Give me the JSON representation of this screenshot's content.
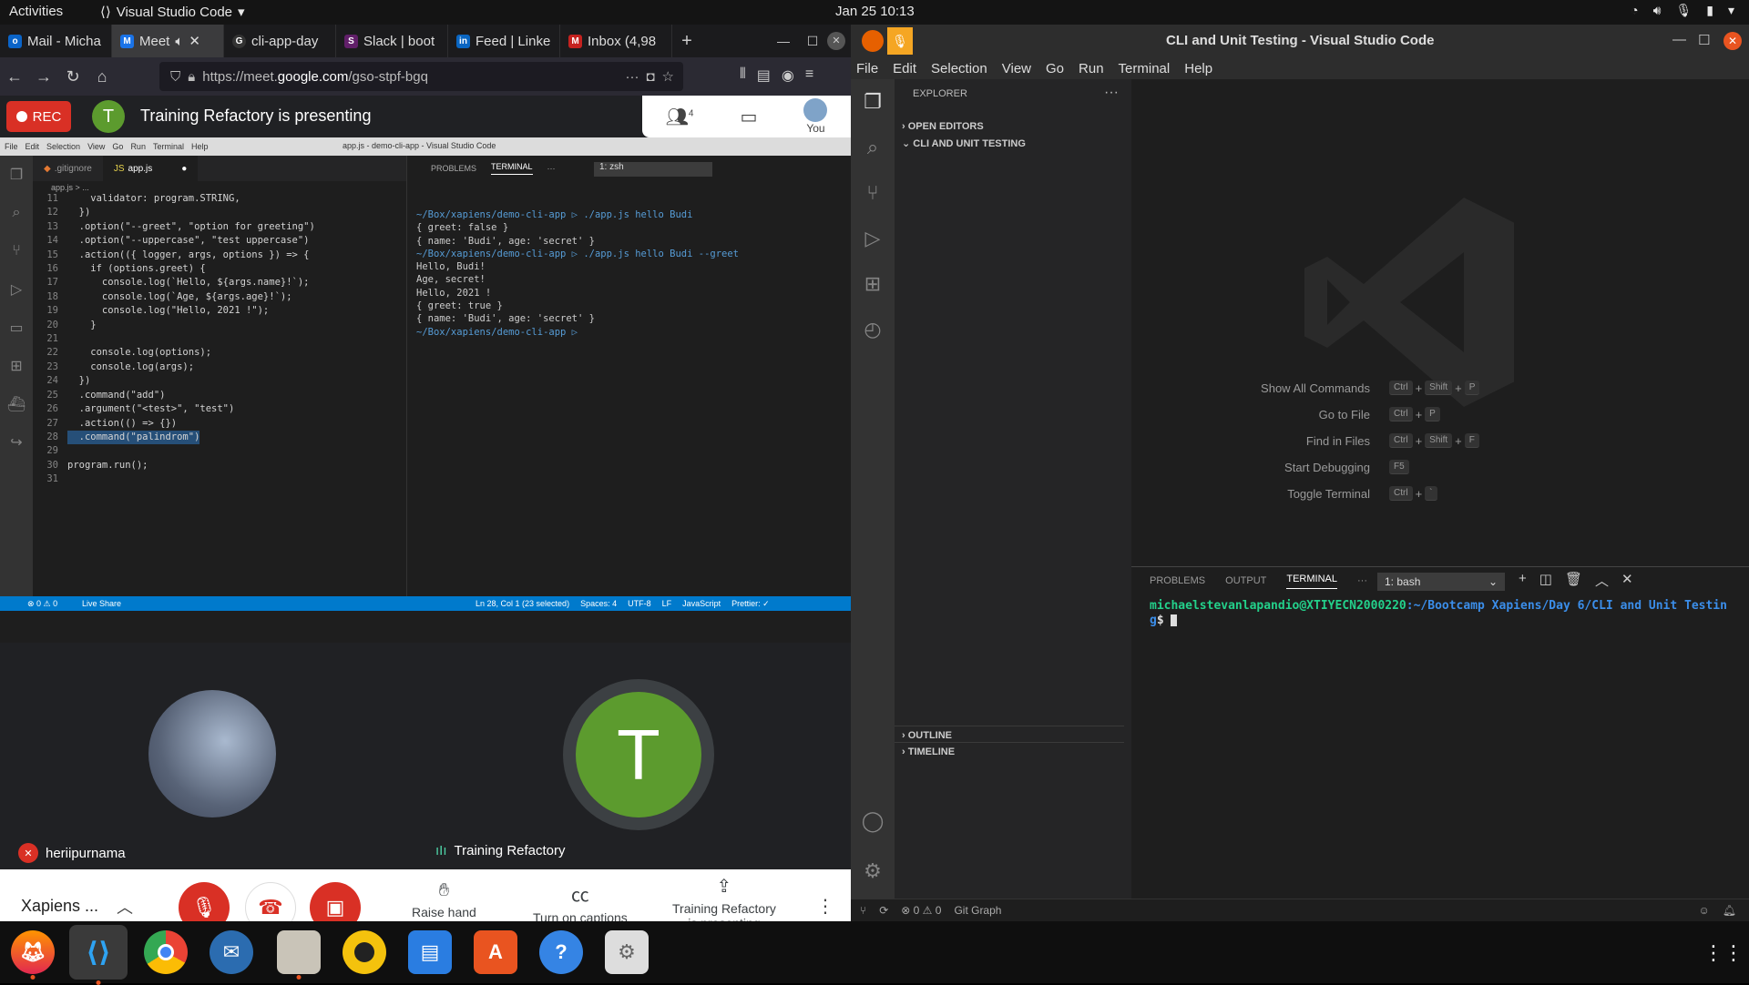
{
  "topbar": {
    "activities": "Activities",
    "app": "Visual Studio Code",
    "clock": "Jan 25  10:13"
  },
  "firefox": {
    "tabs": [
      {
        "label": "Mail - Micha",
        "color": "#0a64c8",
        "glyph": "o"
      },
      {
        "label": "Meet",
        "color": "#1a73e8",
        "glyph": "M"
      },
      {
        "label": "cli-app-day",
        "color": "#333333",
        "glyph": "G"
      },
      {
        "label": "Slack | boot",
        "color": "#611f69",
        "glyph": "S"
      },
      {
        "label": "Feed | Linke",
        "color": "#0a66c2",
        "glyph": "in"
      },
      {
        "label": "Inbox (4,98",
        "color": "#c5221f",
        "glyph": "M"
      }
    ],
    "url_prefix": "https://meet.",
    "url_domain": "google.com",
    "url_path": "/gso-stpf-bgq"
  },
  "meet": {
    "rec": "REC",
    "presenter_initial": "T",
    "presenting_text": "Training Refactory is presenting",
    "people_count": "4",
    "you": "You",
    "participant1": "heriipurnama",
    "participant2": "Training Refactory",
    "participant2_initial": "T",
    "meeting_name": "Xapiens ...",
    "raise_hand": "Raise hand",
    "captions": "Turn on captions",
    "presenting_line1": "Training Refactory",
    "presenting_line2": "is presenting"
  },
  "shared_vscode": {
    "menu": [
      "File",
      "Edit",
      "Selection",
      "View",
      "Go",
      "Run",
      "Terminal",
      "Help"
    ],
    "title": "app.js - demo-cli-app - Visual Studio Code",
    "tabs": [
      ".gitignore",
      "app.js"
    ],
    "breadcrumb": "app.js > ...",
    "code": [
      {
        "n": "11",
        "t": "    validator: program.STRING,"
      },
      {
        "n": "12",
        "t": "  })"
      },
      {
        "n": "13",
        "t": "  .option(\"--greet\", \"option for greeting\")"
      },
      {
        "n": "14",
        "t": "  .option(\"--uppercase\", \"test uppercase\")"
      },
      {
        "n": "15",
        "t": "  .action(({ logger, args, options }) => {"
      },
      {
        "n": "16",
        "t": "    if (options.greet) {"
      },
      {
        "n": "17",
        "t": "      console.log(`Hello, ${args.name}!`);"
      },
      {
        "n": "18",
        "t": "      console.log(`Age, ${args.age}!`);"
      },
      {
        "n": "19",
        "t": "      console.log(\"Hello, 2021 !\");"
      },
      {
        "n": "20",
        "t": "    }"
      },
      {
        "n": "21",
        "t": ""
      },
      {
        "n": "22",
        "t": "    console.log(options);"
      },
      {
        "n": "23",
        "t": "    console.log(args);"
      },
      {
        "n": "24",
        "t": "  })"
      },
      {
        "n": "25",
        "t": "  .command(\"add\")"
      },
      {
        "n": "26",
        "t": "  .argument(\"<test>\", \"test\")"
      },
      {
        "n": "27",
        "t": "  .action(() => {})"
      },
      {
        "n": "28",
        "t": "  .command(\"palindrom\")"
      },
      {
        "n": "29",
        "t": ""
      },
      {
        "n": "30",
        "t": "program.run();"
      },
      {
        "n": "31",
        "t": ""
      }
    ],
    "term_tabs": [
      "PROBLEMS",
      "TERMINAL"
    ],
    "term_select": "1: zsh",
    "terminal": [
      "~/Box/xapiens/demo-cli-app ▷ ./app.js hello Budi",
      "{ greet: false }",
      "{ name: 'Budi', age: 'secret' }",
      "~/Box/xapiens/demo-cli-app ▷ ./app.js hello Budi --greet",
      "Hello, Budi!",
      "Age, secret!",
      "Hello, 2021 !",
      "{ greet: true }",
      "{ name: 'Budi', age: 'secret' }",
      "~/Box/xapiens/demo-cli-app ▷ "
    ],
    "status_left": "⊗ 0 ⚠ 0",
    "live_share": "Live Share",
    "status_right": [
      "Ln 28, Col 1 (23 selected)",
      "Spaces: 4",
      "UTF-8",
      "LF",
      "JavaScript",
      "Prettier: ✓"
    ]
  },
  "vscode": {
    "title": "CLI and Unit Testing - Visual Studio Code",
    "menu": [
      "File",
      "Edit",
      "Selection",
      "View",
      "Go",
      "Run",
      "Terminal",
      "Help"
    ],
    "explorer": "EXPLORER",
    "open_editors": "OPEN EDITORS",
    "folder": "CLI AND UNIT TESTING",
    "outline": "OUTLINE",
    "timeline": "TIMELINE",
    "shortcuts": [
      {
        "label": "Show All Commands",
        "keys": [
          "Ctrl",
          "Shift",
          "P"
        ]
      },
      {
        "label": "Go to File",
        "keys": [
          "Ctrl",
          "P"
        ]
      },
      {
        "label": "Find in Files",
        "keys": [
          "Ctrl",
          "Shift",
          "F"
        ]
      },
      {
        "label": "Start Debugging",
        "keys": [
          "F5"
        ]
      },
      {
        "label": "Toggle Terminal",
        "keys": [
          "Ctrl",
          "`"
        ]
      }
    ],
    "panel_tabs": [
      "PROBLEMS",
      "OUTPUT",
      "TERMINAL"
    ],
    "terminal_select": "1: bash",
    "prompt_user": "michaelstevanlapandio@XTIYECN2000220",
    "prompt_path": ":~/Bootcamp Xapiens/Day 6/CLI and Unit Testing",
    "prompt_end": "$",
    "status_problems": "⊗ 0 ⚠ 0",
    "git_graph": "Git Graph"
  }
}
